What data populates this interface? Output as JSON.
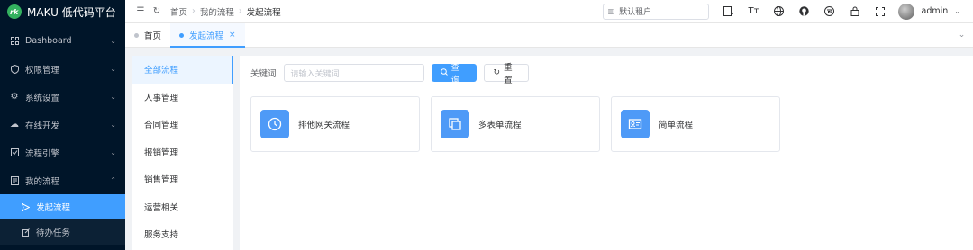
{
  "app": {
    "title": "MAKU 低代码平台",
    "logo_glyph": "rk"
  },
  "sidebar": {
    "items": [
      {
        "label": "Dashboard",
        "icon": "grid-icon"
      },
      {
        "label": "权限管理",
        "icon": "shield-icon"
      },
      {
        "label": "系统设置",
        "icon": "gear-icon"
      },
      {
        "label": "在线开发",
        "icon": "cloud-icon"
      },
      {
        "label": "流程引擎",
        "icon": "check-square-icon"
      },
      {
        "label": "我的流程",
        "icon": "document-icon",
        "expanded": true
      }
    ],
    "sub_items": [
      {
        "label": "发起流程",
        "icon": "send-icon",
        "active": true
      },
      {
        "label": "待办任务",
        "icon": "edit-icon"
      }
    ]
  },
  "header": {
    "breadcrumb": [
      "首页",
      "我的流程",
      "发起流程"
    ],
    "tenant_placeholder": "默认租户",
    "user": {
      "name": "admin"
    }
  },
  "tabs": [
    {
      "label": "首页",
      "active": false
    },
    {
      "label": "发起流程",
      "active": true,
      "close": "×"
    }
  ],
  "categories": [
    "全部流程",
    "人事管理",
    "合同管理",
    "报销管理",
    "销售管理",
    "运营相关",
    "服务支持"
  ],
  "search": {
    "label": "关键词",
    "placeholder": "请输入关键词",
    "query_button": "查询",
    "reset_button": "重置"
  },
  "cards": [
    {
      "label": "排他网关流程",
      "icon": "clock-icon"
    },
    {
      "label": "多表单流程",
      "icon": "copy-icon"
    },
    {
      "label": "简单流程",
      "icon": "id-card-icon"
    }
  ],
  "colors": {
    "accent": "#409eff",
    "sidebar_bg": "#001529",
    "card_icon_bg": "#4e9af7"
  }
}
